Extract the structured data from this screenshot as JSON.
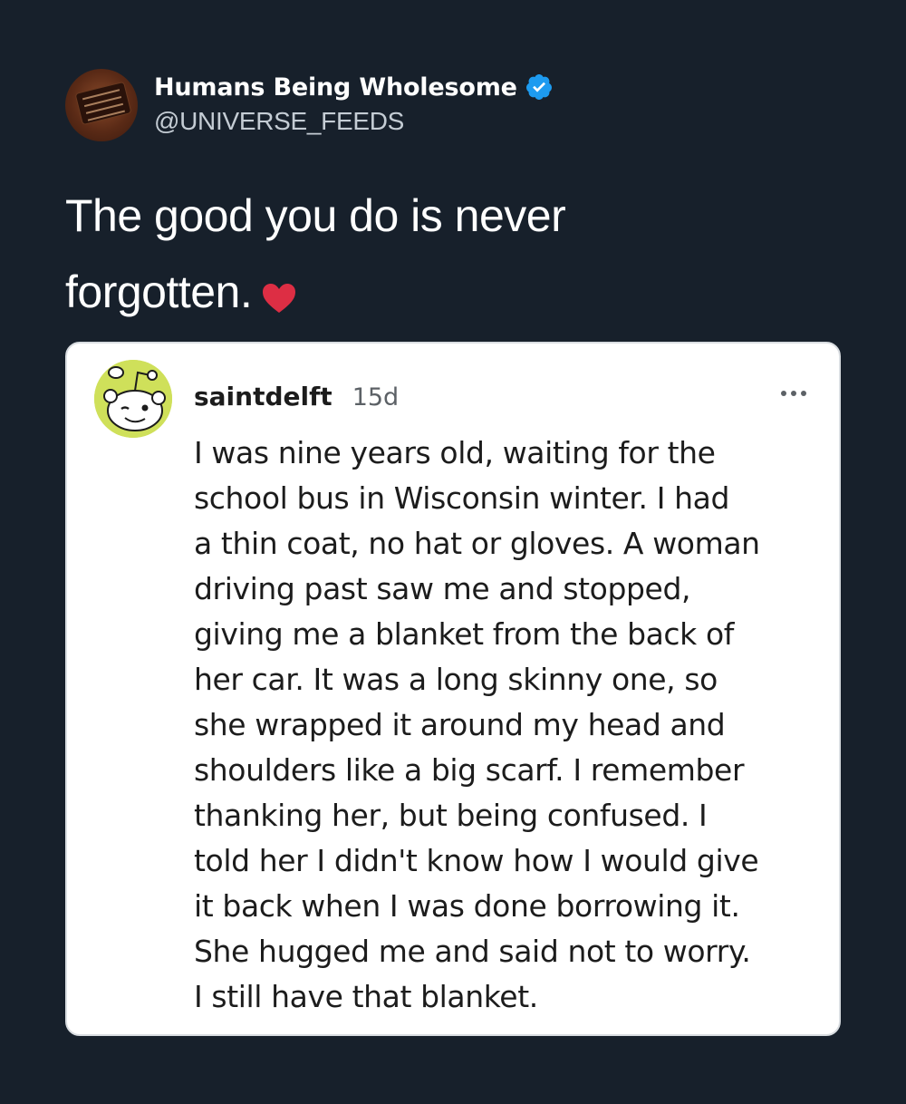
{
  "tweet": {
    "author": {
      "display_name": "Humans Being Wholesome",
      "handle": "@UNIVERSE_FEEDS",
      "verified": true,
      "verified_icon": "verified-badge-icon"
    },
    "text_lines": [
      "The good you do is never",
      "forgotten."
    ],
    "emoji": "red-heart-icon"
  },
  "embedded_post": {
    "username": "saintdelft",
    "age": "15d",
    "menu_icon": "more-options-icon",
    "avatar_icon": "snoo-avatar-icon",
    "body_lines": [
      "I was nine years old, waiting for the",
      "school bus in Wisconsin winter. I had",
      "a thin coat, no hat or gloves. A woman",
      "driving past saw me and stopped,",
      "giving me a blanket from the back of",
      "her car. It was a long skinny one, so",
      "she wrapped it around my head and",
      "shoulders like a big scarf. I remember",
      "thanking her, but being confused. I",
      "told her I didn't know how I would give",
      "it back when I was done borrowing it.",
      "She hugged me and said not to worry.",
      "I still have that blanket."
    ]
  },
  "colors": {
    "background": "#17202b",
    "verified_blue": "#1d9bf0",
    "heart_red": "#dd2e44",
    "avatar_green": "#cfe05a"
  }
}
